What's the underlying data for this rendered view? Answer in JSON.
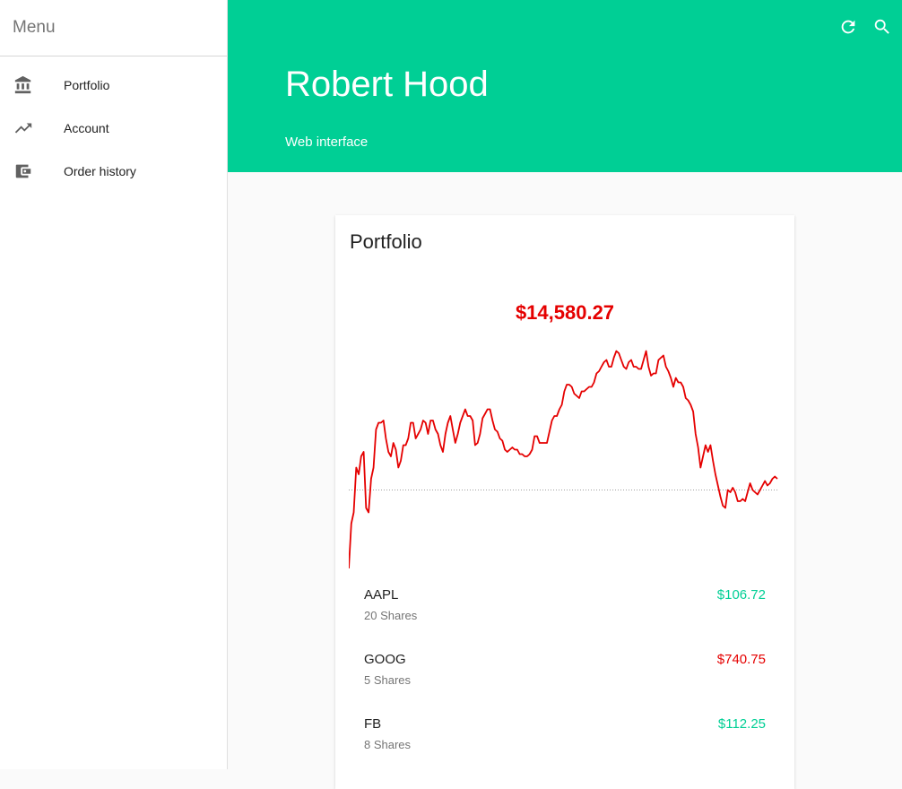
{
  "sidebar": {
    "title": "Menu",
    "items": [
      {
        "label": "Portfolio",
        "icon": "bank-icon"
      },
      {
        "label": "Account",
        "icon": "trending-up-icon"
      },
      {
        "label": "Order history",
        "icon": "wallet-icon"
      }
    ]
  },
  "header": {
    "title": "Robert Hood",
    "subtitle": "Web interface",
    "actions": [
      "refresh-icon",
      "search-icon"
    ],
    "color": "#00cf95"
  },
  "portfolio": {
    "title": "Portfolio",
    "total": "$14,580.27",
    "total_color": "#e50000",
    "stocks": [
      {
        "symbol": "AAPL",
        "shares": "20 Shares",
        "price": "$106.72",
        "color": "#00cf95"
      },
      {
        "symbol": "GOOG",
        "shares": "5 Shares",
        "price": "$740.75",
        "color": "#e50000"
      },
      {
        "symbol": "FB",
        "shares": "8 Shares",
        "price": "$112.25",
        "color": "#00cf95"
      }
    ]
  },
  "chart_data": {
    "type": "line",
    "line_color": "#e50000",
    "baseline": 0.35,
    "values": [
      0.0,
      0.2,
      0.25,
      0.45,
      0.42,
      0.5,
      0.52,
      0.27,
      0.25,
      0.4,
      0.45,
      0.62,
      0.65,
      0.65,
      0.66,
      0.58,
      0.52,
      0.5,
      0.56,
      0.53,
      0.45,
      0.48,
      0.55,
      0.55,
      0.58,
      0.65,
      0.65,
      0.58,
      0.6,
      0.62,
      0.66,
      0.65,
      0.6,
      0.66,
      0.66,
      0.62,
      0.6,
      0.55,
      0.52,
      0.6,
      0.65,
      0.68,
      0.62,
      0.56,
      0.6,
      0.65,
      0.68,
      0.71,
      0.68,
      0.68,
      0.66,
      0.55,
      0.56,
      0.6,
      0.67,
      0.69,
      0.71,
      0.71,
      0.66,
      0.62,
      0.61,
      0.58,
      0.57,
      0.53,
      0.52,
      0.53,
      0.54,
      0.53,
      0.53,
      0.51,
      0.51,
      0.5,
      0.5,
      0.51,
      0.53,
      0.59,
      0.59,
      0.56,
      0.56,
      0.56,
      0.56,
      0.61,
      0.66,
      0.68,
      0.68,
      0.71,
      0.73,
      0.79,
      0.82,
      0.82,
      0.81,
      0.78,
      0.77,
      0.76,
      0.79,
      0.79,
      0.8,
      0.81,
      0.81,
      0.83,
      0.87,
      0.88,
      0.9,
      0.92,
      0.93,
      0.9,
      0.9,
      0.94,
      0.97,
      0.96,
      0.93,
      0.9,
      0.89,
      0.92,
      0.93,
      0.9,
      0.9,
      0.89,
      0.89,
      0.93,
      0.97,
      0.9,
      0.86,
      0.87,
      0.87,
      0.93,
      0.94,
      0.95,
      0.9,
      0.88,
      0.85,
      0.81,
      0.85,
      0.83,
      0.83,
      0.81,
      0.76,
      0.75,
      0.73,
      0.7,
      0.6,
      0.54,
      0.45,
      0.5,
      0.55,
      0.52,
      0.55,
      0.48,
      0.42,
      0.37,
      0.32,
      0.28,
      0.27,
      0.35,
      0.34,
      0.36,
      0.34,
      0.3,
      0.3,
      0.31,
      0.3,
      0.34,
      0.38,
      0.35,
      0.34,
      0.33,
      0.35,
      0.37,
      0.39,
      0.37,
      0.38,
      0.4,
      0.41,
      0.4
    ]
  }
}
